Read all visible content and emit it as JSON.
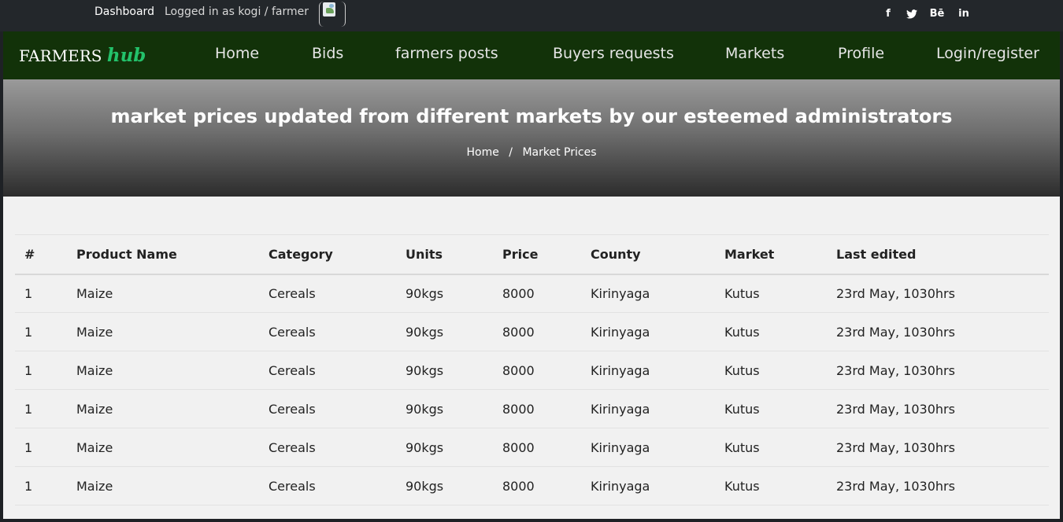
{
  "topbar": {
    "dashboard_link": "Dashboard",
    "logged_in_text": "Logged in as kogi / farmer",
    "social": [
      {
        "icon": "facebook-icon",
        "glyph": "f"
      },
      {
        "icon": "twitter-icon",
        "glyph": "🐦"
      },
      {
        "icon": "behance-icon",
        "glyph": "Bē"
      },
      {
        "icon": "linkedin-icon",
        "glyph": "in"
      }
    ]
  },
  "brand": {
    "name": "FARMERS",
    "accent": "hub",
    "accent_color": "#23c26b"
  },
  "nav": {
    "items": [
      "Home",
      "Bids",
      "farmers posts",
      "Buyers requests",
      "Markets",
      "Profile",
      "Login/register"
    ]
  },
  "banner": {
    "title": "market prices updated from different markets by our esteemed administrators",
    "breadcrumb": [
      "Home",
      "Market Prices"
    ],
    "separator": "/"
  },
  "table": {
    "headers": [
      "#",
      "Product Name",
      "Category",
      "Units",
      "Price",
      "County",
      "Market",
      "Last edited"
    ],
    "rows": [
      [
        "1",
        "Maize",
        "Cereals",
        "90kgs",
        "8000",
        "Kirinyaga",
        "Kutus",
        "23rd May, 1030hrs"
      ],
      [
        "1",
        "Maize",
        "Cereals",
        "90kgs",
        "8000",
        "Kirinyaga",
        "Kutus",
        "23rd May, 1030hrs"
      ],
      [
        "1",
        "Maize",
        "Cereals",
        "90kgs",
        "8000",
        "Kirinyaga",
        "Kutus",
        "23rd May, 1030hrs"
      ],
      [
        "1",
        "Maize",
        "Cereals",
        "90kgs",
        "8000",
        "Kirinyaga",
        "Kutus",
        "23rd May, 1030hrs"
      ],
      [
        "1",
        "Maize",
        "Cereals",
        "90kgs",
        "8000",
        "Kirinyaga",
        "Kutus",
        "23rd May, 1030hrs"
      ],
      [
        "1",
        "Maize",
        "Cereals",
        "90kgs",
        "8000",
        "Kirinyaga",
        "Kutus",
        "23rd May, 1030hrs"
      ]
    ]
  },
  "colors": {
    "navbar": "#123209",
    "topbar": "#23272b",
    "page_background": "#f1f1f1"
  }
}
